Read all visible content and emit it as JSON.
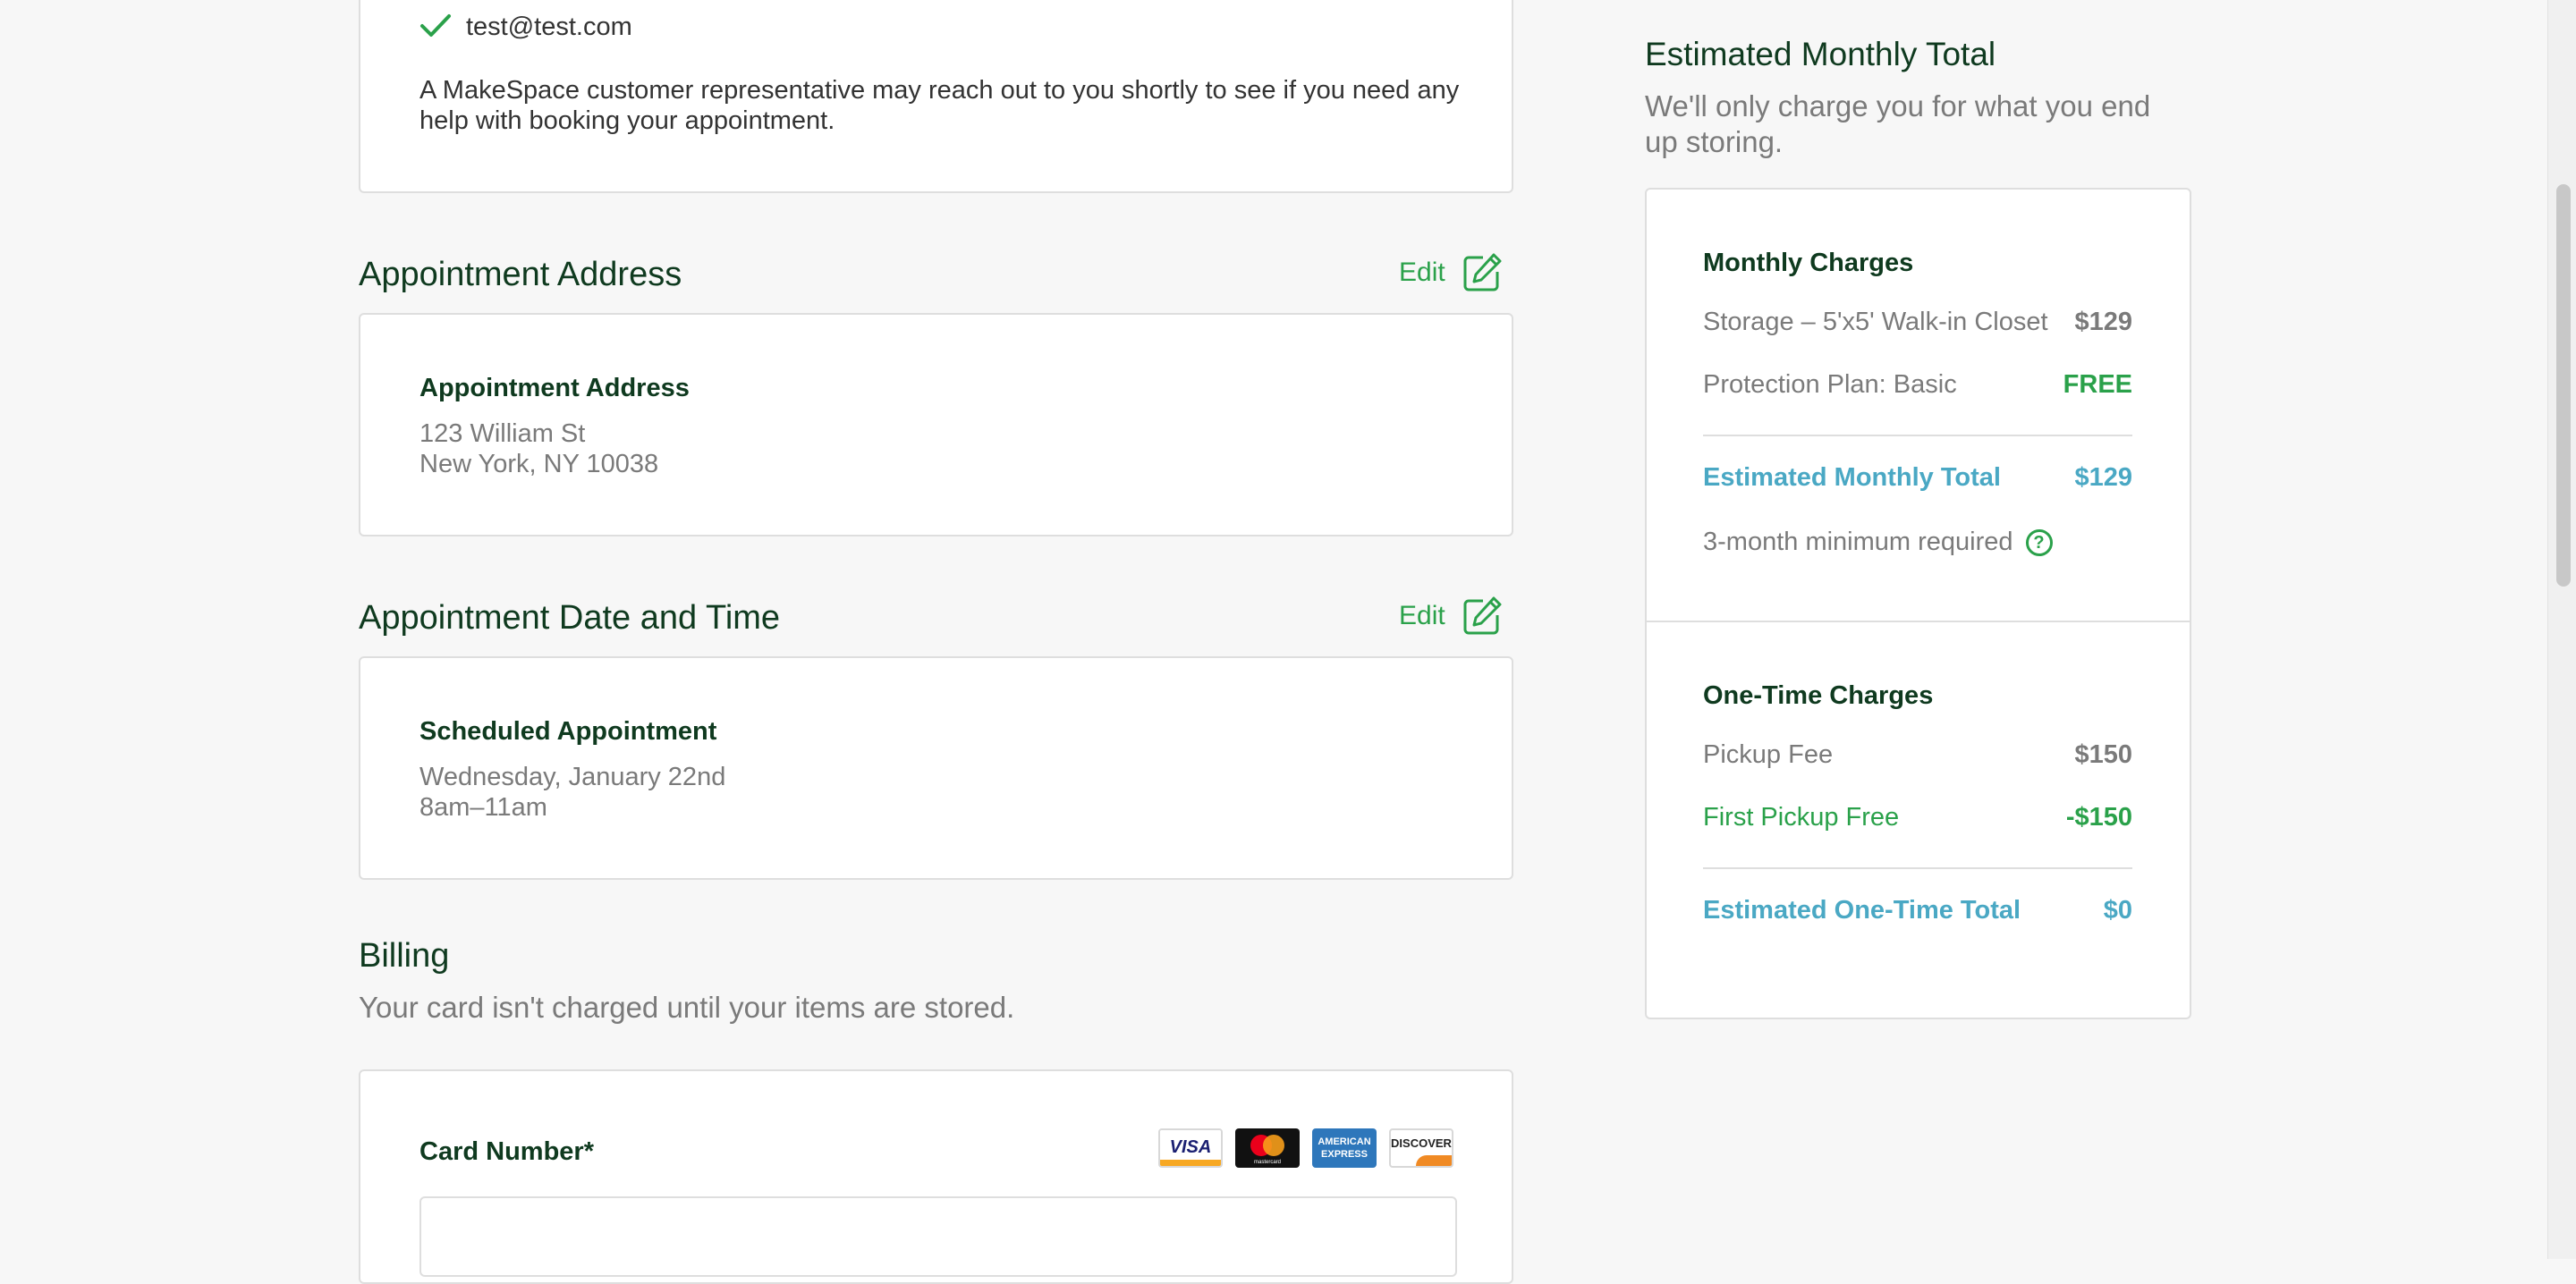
{
  "contact": {
    "email": "test@test.com",
    "note": "A MakeSpace customer representative may reach out to you shortly to see if you need any help with booking your appointment."
  },
  "address_section": {
    "heading": "Appointment Address",
    "edit_label": "Edit",
    "card_title": "Appointment Address",
    "line1": "123 William St",
    "line2": "New York, NY 10038"
  },
  "datetime_section": {
    "heading": "Appointment Date and Time",
    "edit_label": "Edit",
    "card_title": "Scheduled Appointment",
    "date": "Wednesday, January 22nd",
    "time": "8am–11am"
  },
  "billing": {
    "heading": "Billing",
    "subheading": "Your card isn't charged until your items are stored.",
    "card_number_label": "Card Number*",
    "card_number_value": "",
    "card_brands": [
      "VISA",
      "mastercard",
      "AMERICAN EXPRESS",
      "DISCOVER"
    ]
  },
  "summary": {
    "title": "Estimated Monthly Total",
    "subtitle_line1": "We'll only charge you for what you end",
    "subtitle_line2": "up storing.",
    "monthly": {
      "heading": "Monthly Charges",
      "storage_label": "Storage – 5'x5' Walk-in Closet",
      "storage_value": "$129",
      "protection_label": "Protection Plan: Basic",
      "protection_value": "FREE",
      "total_label": "Estimated Monthly Total",
      "total_value": "$129",
      "minimum_note": "3-month minimum required"
    },
    "onetime": {
      "heading": "One-Time Charges",
      "pickup_label": "Pickup Fee",
      "pickup_value": "$150",
      "promo_label": "First Pickup Free",
      "promo_value": "-$150",
      "total_label": "Estimated One-Time Total",
      "total_value": "$0"
    }
  },
  "colors": {
    "accent_green": "#2aa14a",
    "accent_teal": "#4aa8c4",
    "heading_dark": "#0f3a1f"
  }
}
